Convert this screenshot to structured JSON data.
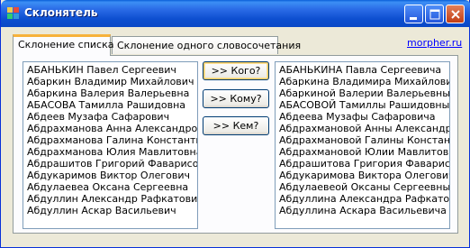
{
  "window": {
    "title": "Склонятель",
    "icon": "app-icon",
    "controls": [
      "minimize-icon",
      "maximize-icon",
      "close-icon"
    ]
  },
  "tabs": [
    {
      "label": "Склонение списка",
      "active": true
    },
    {
      "label": "Склонение одного словосочетания",
      "active": false
    }
  ],
  "link": {
    "label": "morpher.ru"
  },
  "buttons": [
    {
      "label": ">> Кого?"
    },
    {
      "label": ">> Кому?"
    },
    {
      "label": ">> Кем?"
    }
  ],
  "left_list": [
    "АБАНЬКИН Павел Сергеевич",
    "Абаркин Владимир Михайлович",
    "Абаркина Валерия Валерьевна",
    "АБАСОВА Тамилла Рашидовна",
    "Абдеев Музафа Сафарович",
    "Абдрахманова Анна Александровна",
    "Абдрахманова Галина Константинов",
    "Абдрахманова Юлия Мавлитовна",
    "Абдрашитов Григорий Фаварисович",
    "Абдукаримов Виктор Олегович",
    "Абдулаевеа Оксана Сергеевна",
    "Абдуллин Александр Рафкатович",
    "Абдуллин Аскар Васильевич"
  ],
  "right_list": [
    "АБАНЬКИНА Павла Сергеевича",
    "Абаркина Владимира Михайловича",
    "Абаркиной Валерии Валерьевны",
    "АБАСОВОЙ Тамиллы Рашидовны",
    "Абдеева Музафы Сафаровича",
    "Абдрахмановой Анны Александров",
    "Абдрахмановой Галины Константино",
    "Абдрахмановой Юлии Мавлитовны",
    "Абдрашитова Григория Фаварисови",
    "Абдукаримова Виктора Олеговича",
    "Абдулаевеой Оксаны Сергеевны",
    "Абдуллина Александра Рафкатовича",
    "Абдуллина Аскара Васильевича"
  ],
  "colors": {
    "titlebar": "#0a48c6",
    "close_button": "#c23d14",
    "tab_highlight": "#f7b23b",
    "link": "#0000ff",
    "window_bg": "#ece9d8"
  }
}
